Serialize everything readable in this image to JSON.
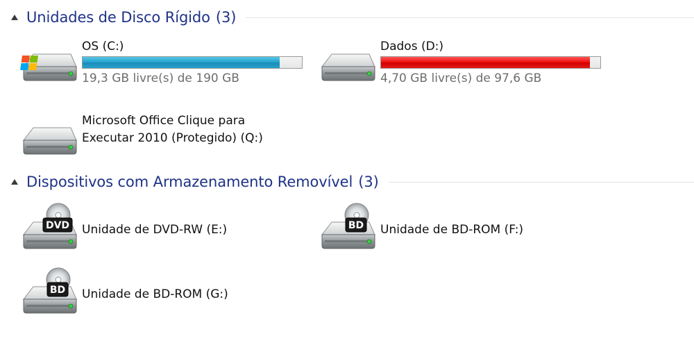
{
  "groups": {
    "hard_disks": {
      "title": "Unidades de Disco Rígido",
      "count": "(3)"
    },
    "removable": {
      "title": "Dispositivos com Armazenamento Removível",
      "count": "(3)"
    }
  },
  "drives": {
    "c": {
      "name": "OS (C:)",
      "space": "19,3 GB livre(s) de 190 GB",
      "used_fraction": 0.898,
      "icon": "windows-drive-icon",
      "bar_color": "#1e9ac6"
    },
    "d": {
      "name": "Dados (D:)",
      "space": "4,70 GB livre(s) de 97,6 GB",
      "used_fraction": 0.952,
      "icon": "hard-drive-icon",
      "bar_color": "#e00000"
    },
    "q": {
      "name_line1": "Microsoft Office Clique para",
      "name_line2": "Executar 2010 (Protegido) (Q:)",
      "icon": "hard-drive-icon"
    },
    "e": {
      "name": "Unidade de DVD-RW (E:)",
      "icon": "dvd-drive-icon",
      "badge": "DVD"
    },
    "f": {
      "name": "Unidade de BD-ROM (F:)",
      "icon": "bd-drive-icon",
      "badge": "BD"
    },
    "g": {
      "name": "Unidade de BD-ROM (G:)",
      "icon": "bd-drive-icon",
      "badge": "BD"
    }
  }
}
